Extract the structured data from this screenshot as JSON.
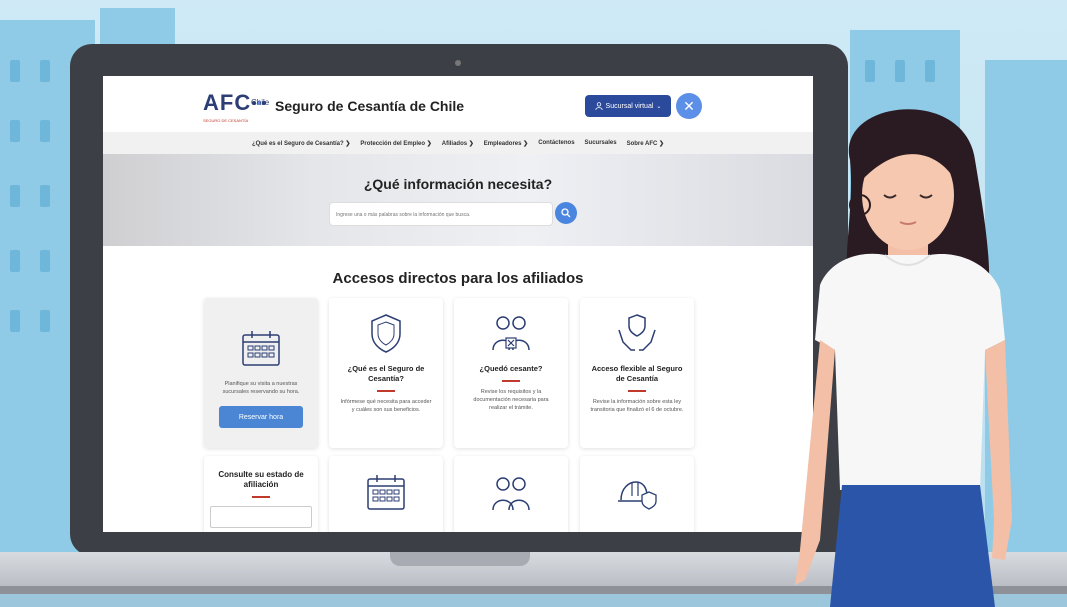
{
  "site": {
    "logo_text": "AFC",
    "logo_chile": "Chile",
    "logo_sub": "SEGURO DE CESANTÍA",
    "title": "Seguro de Cesantía de Chile",
    "branch_button": "Sucursal virtual",
    "close_icon": "close-icon"
  },
  "nav": {
    "items": [
      "¿Qué es el Seguro de Cesantía?",
      "Protección del Empleo",
      "Afiliados",
      "Empleadores",
      "Contáctenos",
      "Sucursales",
      "Sobre AFC"
    ]
  },
  "hero": {
    "title": "¿Qué información necesita?",
    "search_placeholder": "Ingrese una o más palabras sobre la información que busca."
  },
  "section": {
    "title": "Accesos directos para los afiliados"
  },
  "cards": [
    {
      "icon": "calendar-icon",
      "desc": "Planifique su visita a nuestras sucursales reservando su hora.",
      "button": "Reservar hora"
    },
    {
      "icon": "shield-icon",
      "title": "¿Qué es el Seguro de Cesantía?",
      "desc": "Infórmese qué necesita para acceder y cuáles son sus beneficios."
    },
    {
      "icon": "people-icon",
      "title": "¿Quedó cesante?",
      "desc": "Revise los requisitos y la documentación necesaria para realizar el trámite."
    },
    {
      "icon": "hands-shield-icon",
      "title": "Acceso flexible al Seguro de Cesantía",
      "desc": "Revise la información sobre esta ley transitoria que finalizó el 6 de octubre."
    },
    {
      "title": "Consulte su estado de afiliación"
    },
    {
      "icon": "calendar-icon"
    },
    {
      "icon": "people-icon"
    },
    {
      "icon": "helmet-shield-icon"
    }
  ],
  "colors": {
    "brand_navy": "#2c3e73",
    "button_blue": "#2b4a9c",
    "accent_red": "#c0392b",
    "action_blue": "#4a86d4"
  }
}
